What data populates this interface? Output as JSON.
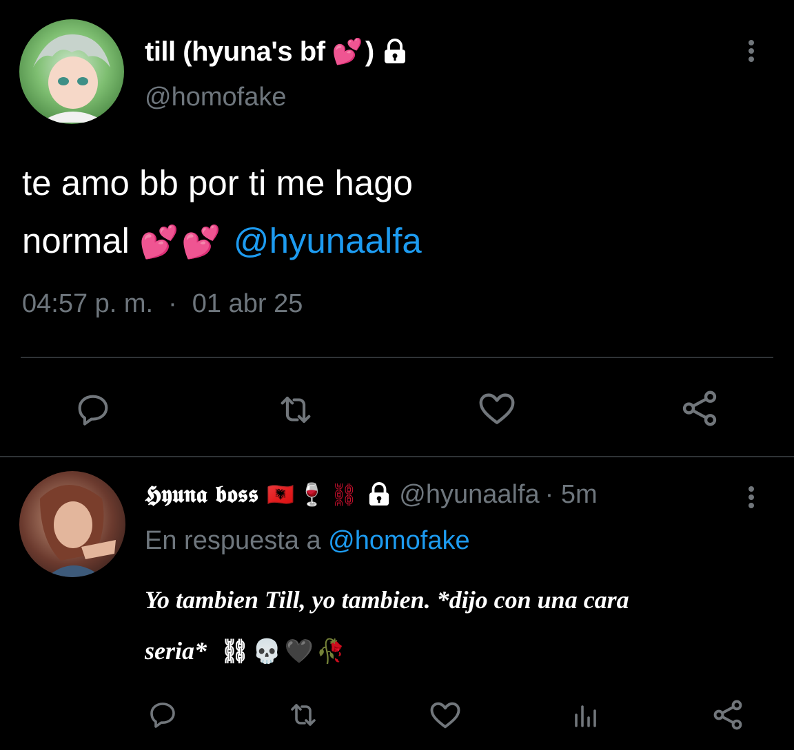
{
  "main_tweet": {
    "display_name": "till (hyuna's bf",
    "name_emoji": "💕",
    "name_close": ")",
    "handle": "@homofake",
    "text_line1": "te amo bb por ti me hago",
    "text_line2": "normal",
    "text_emojis": "💕💕",
    "mention": "@hyunaalfa",
    "time": "04:57 p. m.",
    "sep": "·",
    "date": "01 abr 25"
  },
  "reply": {
    "display_name": "𝕳𝖞𝖚𝖓𝖆 𝖇𝖔𝖘𝖘",
    "name_emojis": "🇦🇱🍷⛓",
    "handle": "@hyunaalfa",
    "time": "· 5m",
    "reply_prefix": "En respuesta a",
    "reply_to": "@homofake",
    "text_line1": "Yo tambien Till, yo tambien. *dijo con una cara",
    "text_line2": "seria*",
    "text_emojis": "⛓💀🖤🥀"
  },
  "colors": {
    "background": "#000000",
    "text": "#e7e9ea",
    "muted": "#6e767d",
    "link": "#1d9bf0",
    "divider": "#2f3336",
    "heart_emoji": "#ff4fa6"
  },
  "icons": [
    "lock-icon",
    "more-icon",
    "reply-icon",
    "retweet-icon",
    "like-icon",
    "share-icon",
    "analytics-icon"
  ]
}
